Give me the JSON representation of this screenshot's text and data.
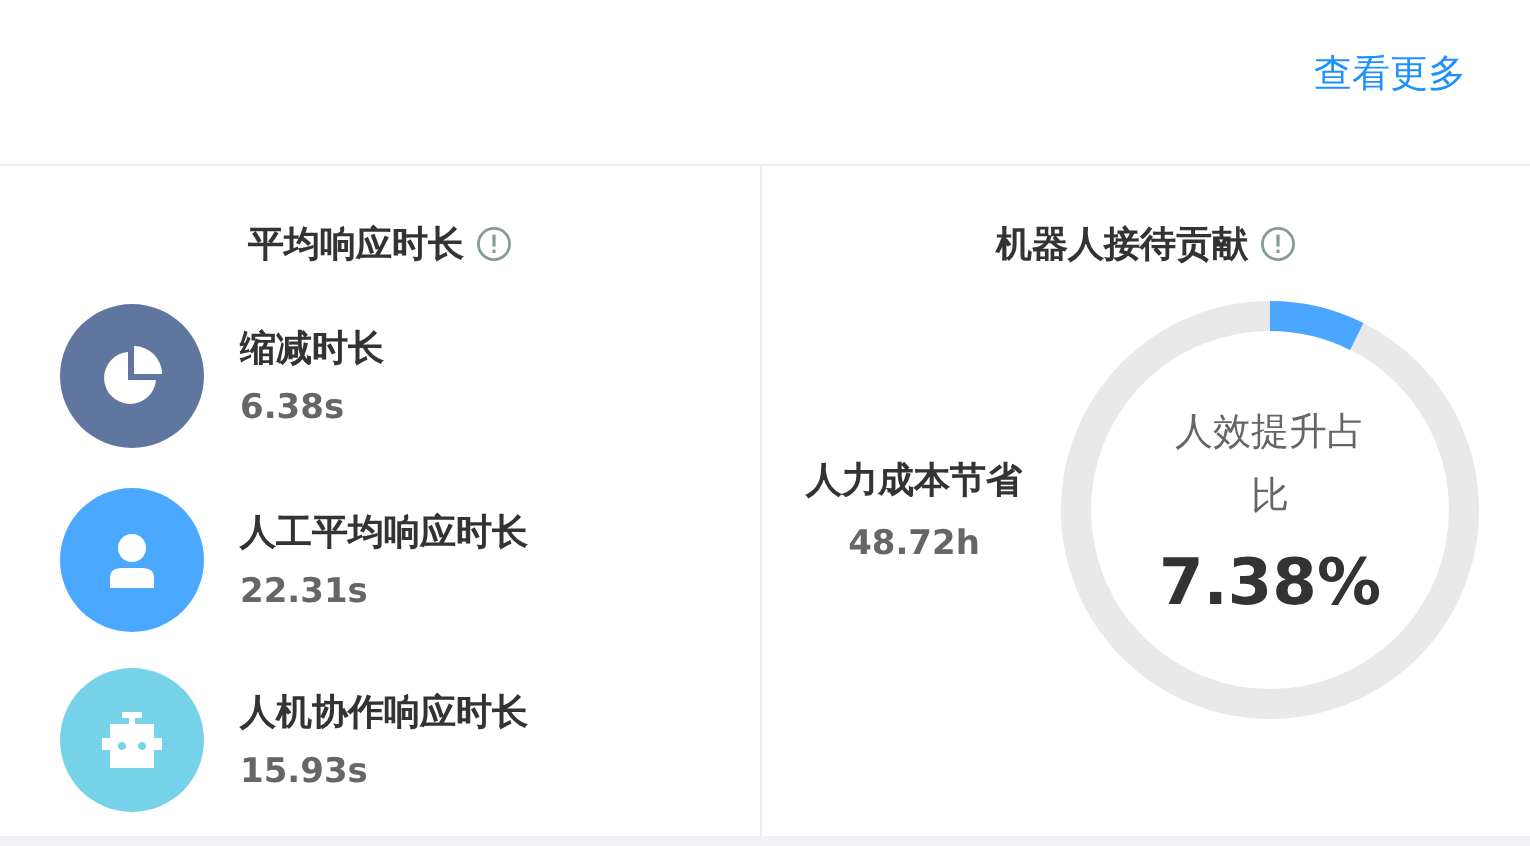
{
  "header": {
    "more_link": "查看更多"
  },
  "response_panel": {
    "title": "平均响应时长",
    "metrics": [
      {
        "kind": "pie",
        "color": "#5f779e",
        "label": "缩减时长",
        "value": "6.38s"
      },
      {
        "kind": "person",
        "color": "#4ba8ff",
        "label": "人工平均响应时长",
        "value": "22.31s"
      },
      {
        "kind": "robot",
        "color": "#76d2e9",
        "label": "人机协作响应时长",
        "value": "15.93s"
      }
    ]
  },
  "robot_panel": {
    "title": "机器人接待贡献",
    "saving_label": "人力成本节省",
    "saving_value": "48.72h",
    "ring": {
      "caption": "人效提升占比",
      "reading": "7.38%"
    }
  }
}
